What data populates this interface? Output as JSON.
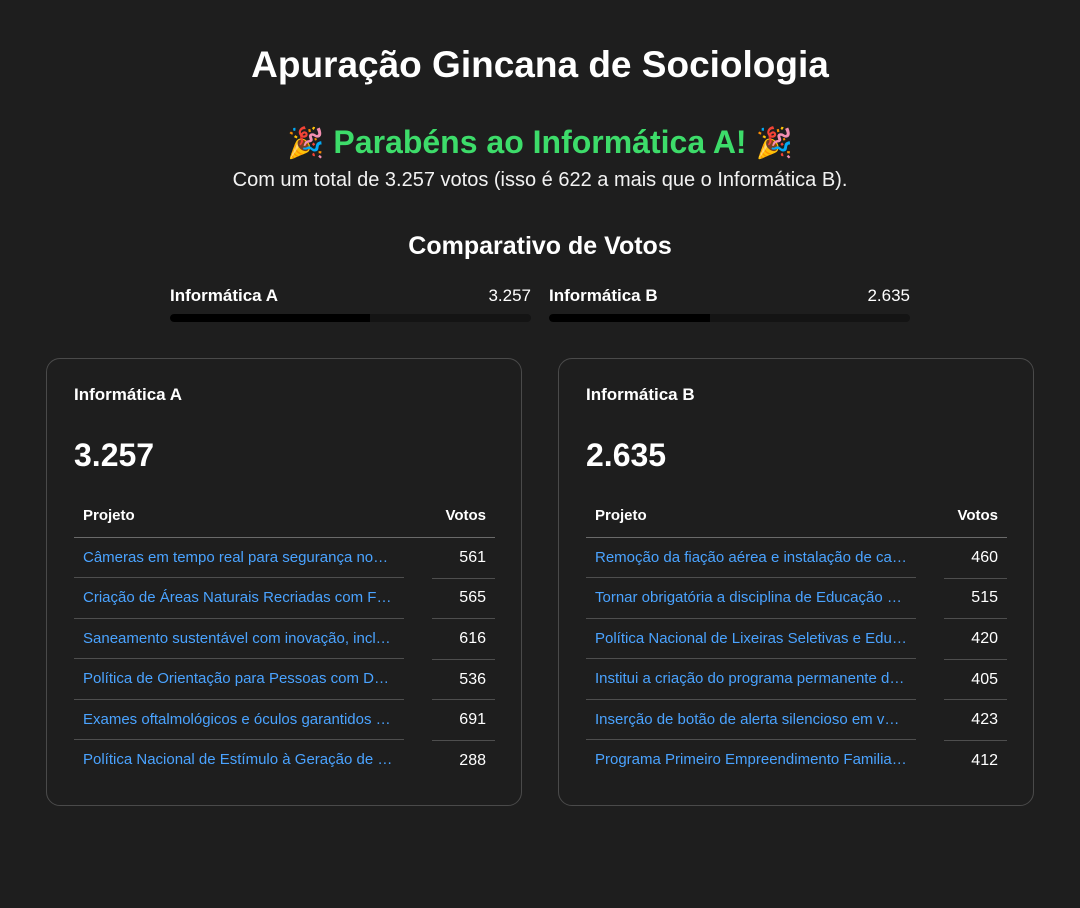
{
  "header": {
    "title": "Apuração Gincana de Sociologia",
    "congrats_emoji": "🎉",
    "congrats_text": "Parabéns ao Informática A!",
    "summary": "Com um total de 3.257 votos (isso é 622 a mais que o Informática B)."
  },
  "comparison": {
    "title": "Comparativo de Votos",
    "teams": [
      {
        "name": "Informática A",
        "votes": "3.257",
        "fill_fraction": 0.553
      },
      {
        "name": "Informática B",
        "votes": "2.635",
        "fill_fraction": 0.447
      }
    ]
  },
  "colors": {
    "background": "#1e1e1e",
    "accent_green": "#3ddc6a",
    "link_blue": "#4aa3ff"
  },
  "cards": [
    {
      "name": "Informática A",
      "total": "3.257",
      "col_project": "Projeto",
      "col_votes": "Votos",
      "rows": [
        {
          "project": "Câmeras em tempo real para segurança nos…",
          "votes": "561"
        },
        {
          "project": "Criação de Áreas Naturais Recriadas com F…",
          "votes": "565"
        },
        {
          "project": "Saneamento sustentável com inovação, incl…",
          "votes": "616"
        },
        {
          "project": "Política de Orientação para Pessoas com De…",
          "votes": "536"
        },
        {
          "project": "Exames oftalmológicos e óculos garantidos …",
          "votes": "691"
        },
        {
          "project": "Política Nacional de Estímulo à Geração de …",
          "votes": "288"
        }
      ]
    },
    {
      "name": "Informática B",
      "total": "2.635",
      "col_project": "Projeto",
      "col_votes": "Votos",
      "rows": [
        {
          "project": "Remoção da fiação aérea e instalação de ca…",
          "votes": "460"
        },
        {
          "project": "Tornar obrigatória a disciplina de Educação …",
          "votes": "515"
        },
        {
          "project": "Política Nacional de Lixeiras Seletivas e Edu…",
          "votes": "420"
        },
        {
          "project": "Institui a criação do programa permanente d…",
          "votes": "405"
        },
        {
          "project": "Inserção de botão de alerta silencioso em v…",
          "votes": "423"
        },
        {
          "project": "Programa Primeiro Empreendimento Familia…",
          "votes": "412"
        }
      ]
    }
  ]
}
